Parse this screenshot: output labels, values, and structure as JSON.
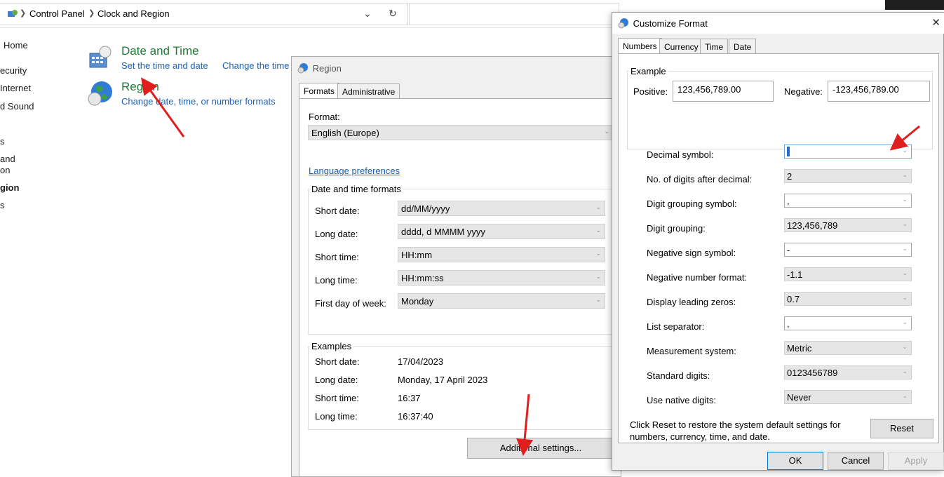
{
  "address_bar": {
    "crumbs": [
      "Control Panel",
      "Clock and Region"
    ],
    "dropdown_icon": "chevron-down-icon",
    "refresh_icon": "refresh-icon"
  },
  "sidebar": {
    "items": [
      "Home",
      "ecurity",
      "Internet",
      "d Sound",
      "s",
      "and",
      "on",
      "gion",
      "s"
    ]
  },
  "categories": {
    "date_time": {
      "title": "Date and Time",
      "links": [
        "Set the time and date",
        "Change the time"
      ]
    },
    "region": {
      "title": "Region",
      "links": [
        "Change date, time, or number formats"
      ]
    }
  },
  "region_dialog": {
    "title": "Region",
    "tabs": [
      "Formats",
      "Administrative"
    ],
    "format_label": "Format:",
    "format_value": "English (Europe)",
    "language_link": "Language preferences",
    "date_time_group": "Date and time formats",
    "rows": [
      {
        "label": "Short date:",
        "value": "dd/MM/yyyy"
      },
      {
        "label": "Long date:",
        "value": "dddd, d MMMM yyyy"
      },
      {
        "label": "Short time:",
        "value": "HH:mm"
      },
      {
        "label": "Long time:",
        "value": "HH:mm:ss"
      },
      {
        "label": "First day of week:",
        "value": "Monday"
      }
    ],
    "examples_group": "Examples",
    "examples": [
      {
        "label": "Short date:",
        "value": "17/04/2023"
      },
      {
        "label": "Long date:",
        "value": "Monday, 17 April 2023"
      },
      {
        "label": "Short time:",
        "value": "16:37"
      },
      {
        "label": "Long time:",
        "value": "16:37:40"
      }
    ],
    "additional_button": "Additional settings..."
  },
  "customize_dialog": {
    "title": "Customize Format",
    "tabs": [
      "Numbers",
      "Currency",
      "Time",
      "Date"
    ],
    "example_group": "Example",
    "positive_label": "Positive:",
    "positive_value": "123,456,789.00",
    "negative_label": "Negative:",
    "negative_value": "-123,456,789.00",
    "rows": [
      {
        "label": "Decimal symbol:",
        "value": ""
      },
      {
        "label": "No. of digits after decimal:",
        "value": "2"
      },
      {
        "label": "Digit grouping symbol:",
        "value": ","
      },
      {
        "label": "Digit grouping:",
        "value": "123,456,789"
      },
      {
        "label": "Negative sign symbol:",
        "value": "-"
      },
      {
        "label": "Negative number format:",
        "value": "-1.1"
      },
      {
        "label": "Display leading zeros:",
        "value": "0.7"
      },
      {
        "label": "List separator:",
        "value": ","
      },
      {
        "label": "Measurement system:",
        "value": "Metric"
      },
      {
        "label": "Standard digits:",
        "value": "0123456789"
      },
      {
        "label": "Use native digits:",
        "value": "Never"
      }
    ],
    "reset_text": "Click Reset to restore the system default settings for numbers, currency, time, and date.",
    "reset_button": "Reset",
    "ok_button": "OK",
    "cancel_button": "Cancel",
    "apply_button": "Apply"
  },
  "colors": {
    "category_title": "#1e7d34",
    "link": "#1a5fb4",
    "annotation_arrow": "#e01e1e",
    "dialog_bg": "#f0f0f0"
  }
}
